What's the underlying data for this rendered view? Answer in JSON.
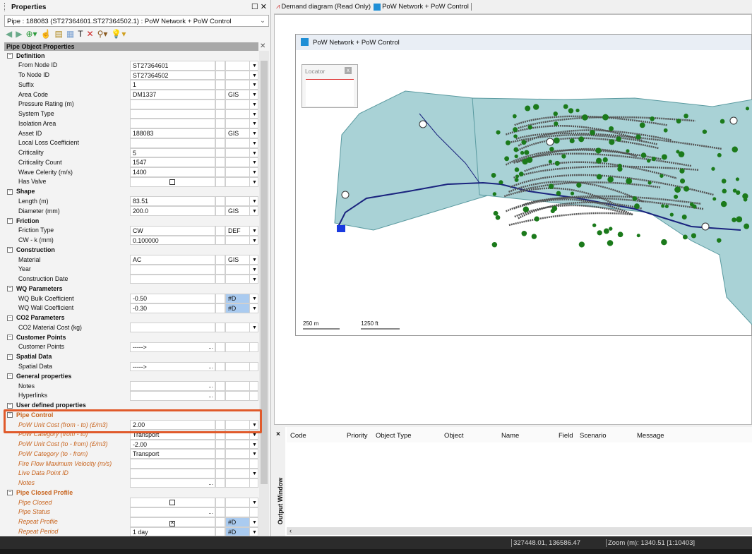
{
  "properties_panel": {
    "title": "Properties",
    "object_selector": "Pipe : 188083 (ST27364601.ST27364502.1) : PoW Network + PoW Control",
    "grid_header": "Pipe Object Properties",
    "rows": [
      {
        "t": "cat",
        "label": "Definition"
      },
      {
        "label": "From Node ID",
        "value": "ST27364601",
        "dd": true
      },
      {
        "label": "To Node ID",
        "value": "ST27364502",
        "dd": true
      },
      {
        "label": "Suffix",
        "value": "1",
        "dd": true
      },
      {
        "label": "Area Code",
        "value": "DM1337",
        "flag": "GIS",
        "dd": true
      },
      {
        "label": "Pressure Rating (m)",
        "dd": true
      },
      {
        "label": "System Type",
        "dd": true
      },
      {
        "label": "Isolation Area",
        "dd": true
      },
      {
        "label": "Asset ID",
        "value": "188083",
        "flag": "GIS",
        "dd": true
      },
      {
        "label": "Local Loss Coefficient",
        "dd": true
      },
      {
        "label": "Criticality",
        "value": "5",
        "dd": true
      },
      {
        "label": "Criticality Count",
        "value": "1547",
        "dd": true
      },
      {
        "label": "Wave Celerity (m/s)",
        "value": "1400",
        "dd": true
      },
      {
        "label": "Has Valve",
        "check": false,
        "dd": true
      },
      {
        "t": "cat",
        "label": "Shape"
      },
      {
        "label": "Length (m)",
        "value": "83.51",
        "dd": true
      },
      {
        "label": "Diameter (mm)",
        "value": "200.0",
        "flag": "GIS",
        "dd": true
      },
      {
        "t": "cat",
        "label": "Friction"
      },
      {
        "label": "Friction Type",
        "value": "CW",
        "flag": "DEF",
        "dd": true
      },
      {
        "label": "CW - k (mm)",
        "value": "0.100000",
        "dd": true
      },
      {
        "t": "cat",
        "label": "Construction"
      },
      {
        "label": "Material",
        "value": "AC",
        "flag": "GIS",
        "dd": true
      },
      {
        "label": "Year",
        "dd": true
      },
      {
        "label": "Construction Date",
        "dd": true
      },
      {
        "t": "cat",
        "label": "WQ Parameters"
      },
      {
        "label": "WQ Bulk Coefficient",
        "value": "-0.50",
        "flag": "#D",
        "hl": true,
        "dd": true
      },
      {
        "label": "WQ Wall Coefficient",
        "value": "-0.30",
        "flag": "#D",
        "hl": true,
        "dd": true
      },
      {
        "t": "cat",
        "label": "CO2 Parameters"
      },
      {
        "label": "CO2 Material Cost (kg)",
        "dd": true
      },
      {
        "t": "cat",
        "label": "Customer Points"
      },
      {
        "label": "Customer Points",
        "value": "----->",
        "ell": true
      },
      {
        "t": "cat",
        "label": "Spatial Data"
      },
      {
        "label": "Spatial Data",
        "value": "----->",
        "ell": true
      },
      {
        "t": "cat",
        "label": "General properties"
      },
      {
        "label": "Notes",
        "ell": true
      },
      {
        "label": "Hyperlinks",
        "ell": true
      },
      {
        "t": "cat",
        "label": "User defined properties"
      },
      {
        "t": "cat",
        "label": "Pipe Control",
        "orange": true
      },
      {
        "label": "PoW Unit Cost (from - to) (£/m3)",
        "value": "2.00",
        "dd": true,
        "orange": true
      },
      {
        "label": "PoW Category (from - to)",
        "value": "Transport",
        "dd": true,
        "orange": true
      },
      {
        "label": "PoW Unit Cost (to - from) (£/m3)",
        "value": "-2.00",
        "dd": true,
        "orange": true
      },
      {
        "label": "PoW Category (to - from)",
        "value": "Transport",
        "dd": true,
        "orange": true
      },
      {
        "label": "Fire Flow Maximum Velocity (m/s)",
        "orange": true
      },
      {
        "label": "Live Data Point ID",
        "dd": true,
        "orange": true
      },
      {
        "label": "Notes",
        "ell": true,
        "orange": true
      },
      {
        "t": "cat",
        "label": "Pipe Closed Profile",
        "orange": true
      },
      {
        "label": "Pipe Closed",
        "check": false,
        "dd": true,
        "orange": true
      },
      {
        "label": "Pipe Status",
        "ell": true,
        "orange": true
      },
      {
        "label": "Repeat Profile",
        "check": true,
        "flag": "#D",
        "hl": true,
        "dd": true,
        "orange": true
      },
      {
        "label": "Repeat Period",
        "value": "1 day",
        "flag": "#D",
        "hl": true,
        "dd": true,
        "orange": true
      }
    ]
  },
  "tabs": [
    {
      "label": "Demand diagram (Read Only)"
    },
    {
      "label": "PoW Network + PoW Control"
    }
  ],
  "map_window": {
    "title": "PoW Network + PoW Control",
    "locator_title": "Locator",
    "scale_m": "250 m",
    "scale_ft": "1250 ft",
    "colors": {
      "zone": "#a9d2d6",
      "pipe": "#1a237e",
      "node": "#1b7a1b"
    }
  },
  "output_window": {
    "title": "Output Window",
    "columns": [
      "Code",
      "Priority",
      "Object Type",
      "Object",
      "Name",
      "Field",
      "Scenario",
      "Message"
    ]
  },
  "status_bar": {
    "coordinates": "327448.01, 136586.47",
    "zoom": "Zoom (m): 1340.51 [1:10403]"
  },
  "accent": "#e05a2b"
}
